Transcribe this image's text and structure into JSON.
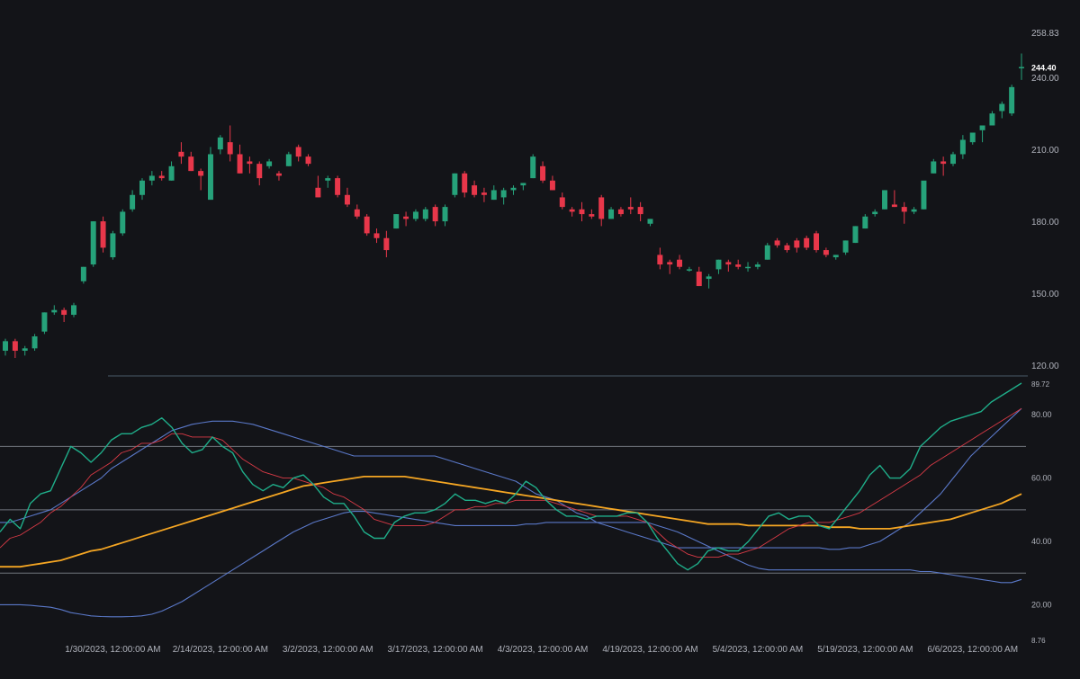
{
  "colors": {
    "background": "#131418",
    "up": "#26a27a",
    "down": "#e8374a",
    "axis_text": "#b0b3bc",
    "last_price_text": "#ffffff",
    "separator": "#4a5a68",
    "level_line": "#72767e",
    "rsi": "#1fae8a",
    "rsi_ma": "#d93a46",
    "bb": "#5a78c8",
    "slow_ma": "#f5a623"
  },
  "chart_data": [
    {
      "type": "candlestick",
      "y_ticks": [
        "120.00",
        "150.00",
        "180.00",
        "210.00",
        "240.00",
        "258.83"
      ],
      "last_price": "244.40",
      "ylim": [
        120,
        258.83
      ],
      "candles": [
        [
          126,
          131,
          124,
          130
        ],
        [
          130,
          131,
          123,
          126
        ],
        [
          126,
          128,
          124,
          127
        ],
        [
          127,
          133,
          126,
          132
        ],
        [
          134,
          142,
          133,
          142
        ],
        [
          142,
          145,
          141,
          143
        ],
        [
          143,
          144,
          138,
          141
        ],
        [
          141,
          146,
          140,
          145
        ],
        [
          155,
          161,
          154,
          161
        ],
        [
          162,
          180,
          161,
          180
        ],
        [
          180,
          182,
          167,
          169
        ],
        [
          165,
          176,
          164,
          175
        ],
        [
          175,
          185,
          174,
          184
        ],
        [
          185,
          193,
          184,
          191
        ],
        [
          191,
          198,
          189,
          197
        ],
        [
          197,
          201,
          195,
          199
        ],
        [
          199,
          201,
          197,
          198
        ],
        [
          197,
          205,
          197,
          203
        ],
        [
          209,
          213,
          204,
          207
        ],
        [
          207,
          209,
          201,
          201
        ],
        [
          201,
          202,
          193,
          199
        ],
        [
          189,
          211,
          189,
          208
        ],
        [
          210,
          216,
          208,
          215
        ],
        [
          213,
          220,
          205,
          208
        ],
        [
          208,
          212,
          200,
          200
        ],
        [
          205,
          207,
          200,
          204
        ],
        [
          204,
          205,
          195,
          198
        ],
        [
          203,
          206,
          202,
          205
        ],
        [
          200,
          201,
          197,
          199
        ],
        [
          203,
          209,
          203,
          208
        ],
        [
          211,
          212,
          205,
          207
        ],
        [
          207,
          208,
          203,
          204
        ],
        [
          194,
          199,
          190,
          190
        ],
        [
          197,
          199,
          194,
          198
        ],
        [
          198,
          199,
          190,
          191
        ],
        [
          191,
          194,
          186,
          187
        ],
        [
          185,
          187,
          181,
          182
        ],
        [
          182,
          183,
          174,
          175
        ],
        [
          175,
          177,
          171,
          173
        ],
        [
          173,
          176,
          165,
          168
        ],
        [
          177,
          183,
          177,
          183
        ],
        [
          182,
          184,
          178,
          181
        ],
        [
          181,
          185,
          180,
          184
        ],
        [
          181,
          186,
          180,
          185
        ],
        [
          186,
          187,
          178,
          180
        ],
        [
          180,
          187,
          178,
          186
        ],
        [
          191,
          200,
          190,
          200
        ],
        [
          200,
          201,
          190,
          192
        ],
        [
          195,
          197,
          190,
          191
        ],
        [
          192,
          194,
          188,
          191
        ],
        [
          189,
          195,
          189,
          193
        ],
        [
          190,
          194,
          187,
          193
        ],
        [
          193,
          195,
          191,
          194
        ],
        [
          195,
          196,
          193,
          196
        ],
        [
          198,
          208,
          198,
          207
        ],
        [
          203,
          205,
          196,
          197
        ],
        [
          197,
          199,
          193,
          193
        ],
        [
          190,
          192,
          185,
          186
        ],
        [
          185,
          186,
          182,
          184
        ],
        [
          185,
          188,
          180,
          183
        ],
        [
          183,
          185,
          181,
          182
        ],
        [
          190,
          191,
          178,
          181
        ],
        [
          181,
          186,
          181,
          185
        ],
        [
          185,
          186,
          182,
          183
        ],
        [
          186,
          190,
          183,
          185
        ],
        [
          186,
          188,
          180,
          183
        ],
        [
          179,
          181,
          178,
          181
        ],
        [
          166,
          169,
          160,
          162
        ],
        [
          163,
          164,
          158,
          162
        ],
        [
          164,
          166,
          160,
          161
        ],
        [
          160,
          161,
          159,
          160
        ],
        [
          159,
          161,
          153,
          153
        ],
        [
          156,
          158,
          152,
          157
        ],
        [
          160,
          164,
          158,
          164
        ],
        [
          163,
          164,
          159,
          162
        ],
        [
          162,
          164,
          160,
          161
        ],
        [
          161,
          163,
          159,
          161
        ],
        [
          161,
          163,
          160,
          162
        ],
        [
          164,
          171,
          164,
          170
        ],
        [
          172,
          173,
          169,
          170
        ],
        [
          170,
          171,
          167,
          168
        ],
        [
          172,
          173,
          167,
          169
        ],
        [
          173,
          174,
          168,
          169
        ],
        [
          175,
          176,
          167,
          168
        ],
        [
          168,
          169,
          165,
          166
        ],
        [
          165,
          166,
          164,
          166
        ],
        [
          167,
          172,
          166,
          172
        ],
        [
          171,
          178,
          171,
          178
        ],
        [
          177,
          183,
          177,
          182
        ],
        [
          183,
          185,
          182,
          184
        ],
        [
          185,
          193,
          185,
          193
        ],
        [
          187,
          193,
          186,
          186
        ],
        [
          186,
          188,
          179,
          184
        ],
        [
          184,
          186,
          183,
          185
        ],
        [
          185,
          196,
          185,
          197
        ],
        [
          200,
          206,
          200,
          205
        ],
        [
          205,
          207,
          199,
          204
        ],
        [
          204,
          209,
          203,
          208
        ],
        [
          208,
          216,
          206,
          214
        ],
        [
          213,
          217,
          212,
          217
        ],
        [
          218,
          218,
          213,
          220
        ],
        [
          220,
          226,
          220,
          225
        ],
        [
          226,
          230,
          223,
          229
        ],
        [
          225,
          237,
          224,
          236
        ],
        [
          244,
          250,
          239,
          244.4
        ]
      ]
    },
    {
      "type": "line",
      "y_ticks": [
        "8.76",
        "20.00",
        "40.00",
        "60.00",
        "80.00",
        "89.72"
      ],
      "ylim": [
        8.76,
        89.72
      ],
      "levels": [
        70,
        50,
        30
      ],
      "x_tick_labels": [
        "1/30/2023, 12:00:00 AM",
        "2/14/2023, 12:00:00 AM",
        "3/2/2023, 12:00:00 AM",
        "3/17/2023, 12:00:00 AM",
        "4/3/2023, 12:00:00 AM",
        "4/19/2023, 12:00:00 AM",
        "5/4/2023, 12:00:00 AM",
        "5/19/2023, 12:00:00 AM",
        "6/6/2023, 12:00:00 AM"
      ],
      "x_tick_index": [
        11,
        22,
        33,
        44,
        55,
        66,
        77,
        88,
        99
      ],
      "series": [
        {
          "values": [
            43,
            47,
            44,
            52,
            55,
            56,
            63,
            70,
            68,
            65,
            68,
            72,
            74,
            74,
            76,
            77,
            79,
            76,
            71,
            68,
            69,
            73,
            70,
            68,
            62,
            58,
            56,
            58,
            57,
            60,
            61,
            58,
            54,
            52,
            52,
            48,
            43,
            41,
            41,
            46,
            48,
            49,
            49,
            50,
            52,
            55,
            53,
            53,
            52,
            53,
            52,
            55,
            59,
            57,
            53,
            50,
            48,
            48,
            47,
            48,
            48,
            48,
            49,
            49,
            46,
            41,
            37,
            33,
            31,
            33,
            37,
            38,
            37,
            37,
            40,
            44,
            48,
            49,
            47,
            48,
            48,
            45,
            44,
            48,
            52,
            56,
            61,
            64,
            60,
            60,
            63,
            70,
            73,
            76,
            78,
            79,
            80,
            81,
            84,
            86,
            88,
            90
          ]
        },
        {
          "values": [
            38,
            41,
            42,
            44,
            46,
            49,
            51,
            54,
            57,
            61,
            63,
            65,
            68,
            69,
            71,
            71,
            72,
            74,
            74,
            73,
            73,
            73,
            72,
            69,
            66,
            64,
            62,
            61,
            60,
            60,
            59,
            58,
            57,
            55,
            54,
            52,
            50,
            47,
            46,
            45,
            45,
            45,
            45,
            46,
            48,
            50,
            50,
            51,
            51,
            52,
            52,
            53,
            53,
            53,
            53,
            52,
            51,
            50,
            49,
            48,
            48,
            48,
            48,
            47,
            46,
            43,
            40,
            38,
            36,
            35,
            35,
            35,
            36,
            36,
            37,
            38,
            40,
            42,
            44,
            45,
            46,
            46,
            46,
            47,
            48,
            49,
            51,
            53,
            55,
            57,
            59,
            61,
            64,
            66,
            68,
            70,
            72,
            74,
            76,
            78,
            80,
            82
          ]
        },
        {
          "values": [
            32,
            32,
            32,
            32.5,
            33,
            33.5,
            34,
            35,
            36,
            37,
            37.5,
            38.5,
            39.5,
            40.5,
            41.5,
            42.5,
            43.5,
            44.5,
            45.5,
            46.5,
            47.5,
            48.5,
            49.5,
            50.5,
            51.5,
            52.5,
            53.5,
            54.5,
            55.5,
            56.5,
            57.5,
            58,
            58.5,
            59,
            59.5,
            60,
            60.5,
            60.5,
            60.5,
            60.5,
            60.5,
            60,
            59.5,
            59,
            58.5,
            58,
            57.5,
            57,
            56.5,
            56,
            55.5,
            55,
            54.5,
            54,
            53.5,
            53,
            52.5,
            52,
            51.5,
            51,
            50.5,
            50,
            49.5,
            49,
            48.5,
            48,
            47.5,
            47,
            46.5,
            46,
            45.5,
            45.5,
            45.5,
            45.5,
            45,
            45,
            45,
            45,
            45,
            45,
            45,
            45,
            44.5,
            44.5,
            44.5,
            44,
            44,
            44,
            44,
            44.5,
            45,
            45.5,
            46,
            46.5,
            47,
            48,
            49,
            50,
            51,
            52,
            53.5,
            55
          ]
        },
        {
          "values": [
            46,
            46,
            47,
            48,
            49,
            50,
            52,
            54,
            56,
            58,
            60,
            63,
            65,
            67,
            69,
            71,
            73,
            75,
            76,
            77,
            77.5,
            78,
            78,
            78,
            77.5,
            77,
            76,
            75,
            74,
            73,
            72,
            71,
            70,
            69,
            68,
            67,
            67,
            67,
            67,
            67,
            67,
            67,
            67,
            67,
            66,
            65,
            64,
            63,
            62,
            61,
            60,
            59,
            57,
            55,
            54,
            53,
            51,
            49,
            48,
            46,
            45,
            44,
            43,
            42,
            41,
            40,
            39,
            38,
            38,
            38,
            38,
            38,
            38,
            38,
            38,
            38,
            38,
            38,
            38,
            38,
            38,
            38,
            37.5,
            37.5,
            38,
            38,
            39,
            40,
            42,
            44,
            46,
            49,
            52,
            55,
            59,
            63,
            67,
            70,
            73,
            76,
            79,
            82
          ]
        },
        {
          "values": [
            20,
            20,
            20,
            19.8,
            19.5,
            19.2,
            18.5,
            17.5,
            17,
            16.5,
            16.3,
            16.2,
            16.2,
            16.3,
            16.5,
            17,
            18,
            19.5,
            21,
            23,
            25,
            27,
            29,
            31,
            33,
            35,
            37,
            39,
            41,
            43,
            44.5,
            46,
            47,
            48,
            49,
            49.5,
            49.5,
            49,
            48.5,
            48,
            47.5,
            47,
            46.5,
            46,
            45.5,
            45,
            45,
            45,
            45,
            45,
            45,
            45,
            45.5,
            45.5,
            46,
            46,
            46,
            46,
            46,
            46,
            46,
            46,
            46,
            46,
            46,
            45,
            44,
            43,
            41.5,
            40,
            38.5,
            37,
            35.5,
            34,
            32.5,
            31.5,
            31,
            31,
            31,
            31,
            31,
            31,
            31,
            31,
            31,
            31,
            31,
            31,
            31,
            31,
            31,
            30.5,
            30.5,
            30,
            29.5,
            29,
            28.5,
            28,
            27.5,
            27,
            27,
            28
          ]
        }
      ]
    }
  ]
}
